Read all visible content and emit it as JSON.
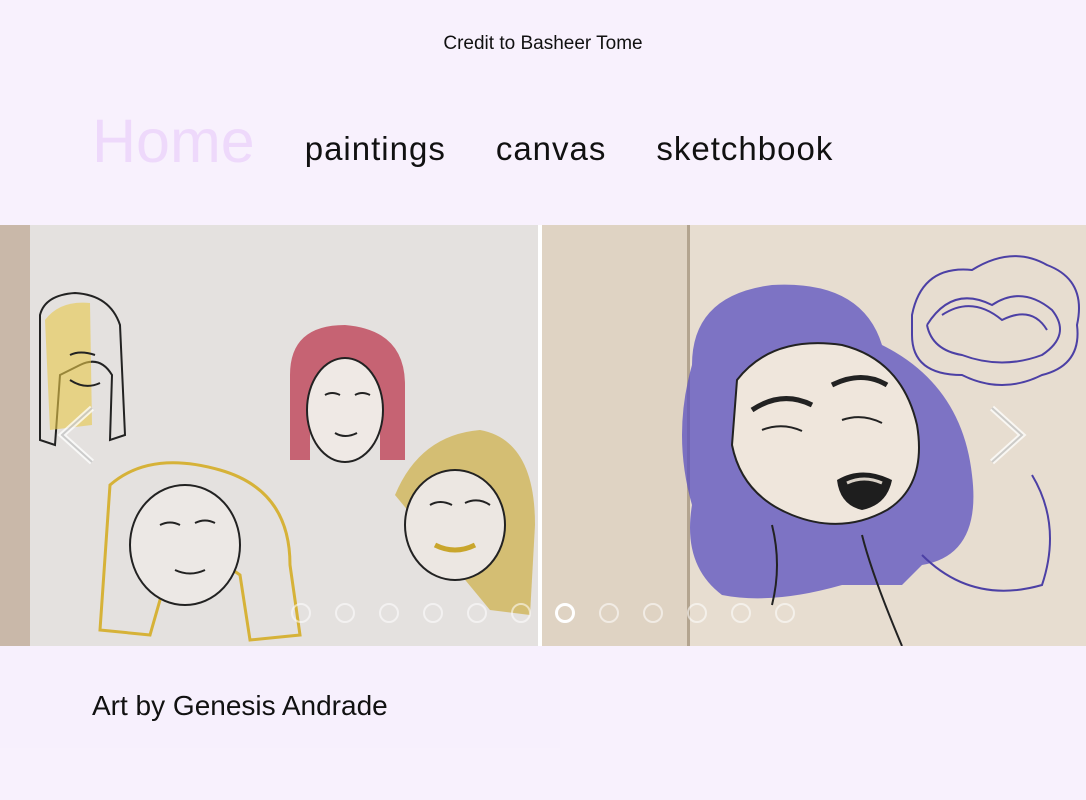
{
  "credit": "Credit to Basheer Tome",
  "nav": {
    "home": "Home",
    "links": [
      "paintings",
      "canvas",
      "sketchbook"
    ]
  },
  "carousel": {
    "dot_count": 12,
    "active_dot": 7
  },
  "footer": {
    "text": "Art by Genesis Andrade"
  },
  "colors": {
    "background": "#f8f1fd",
    "home_link": "#eed9fb",
    "text": "#111111"
  },
  "icons": {
    "prev": "chevron-left-icon",
    "next": "chevron-right-icon"
  }
}
